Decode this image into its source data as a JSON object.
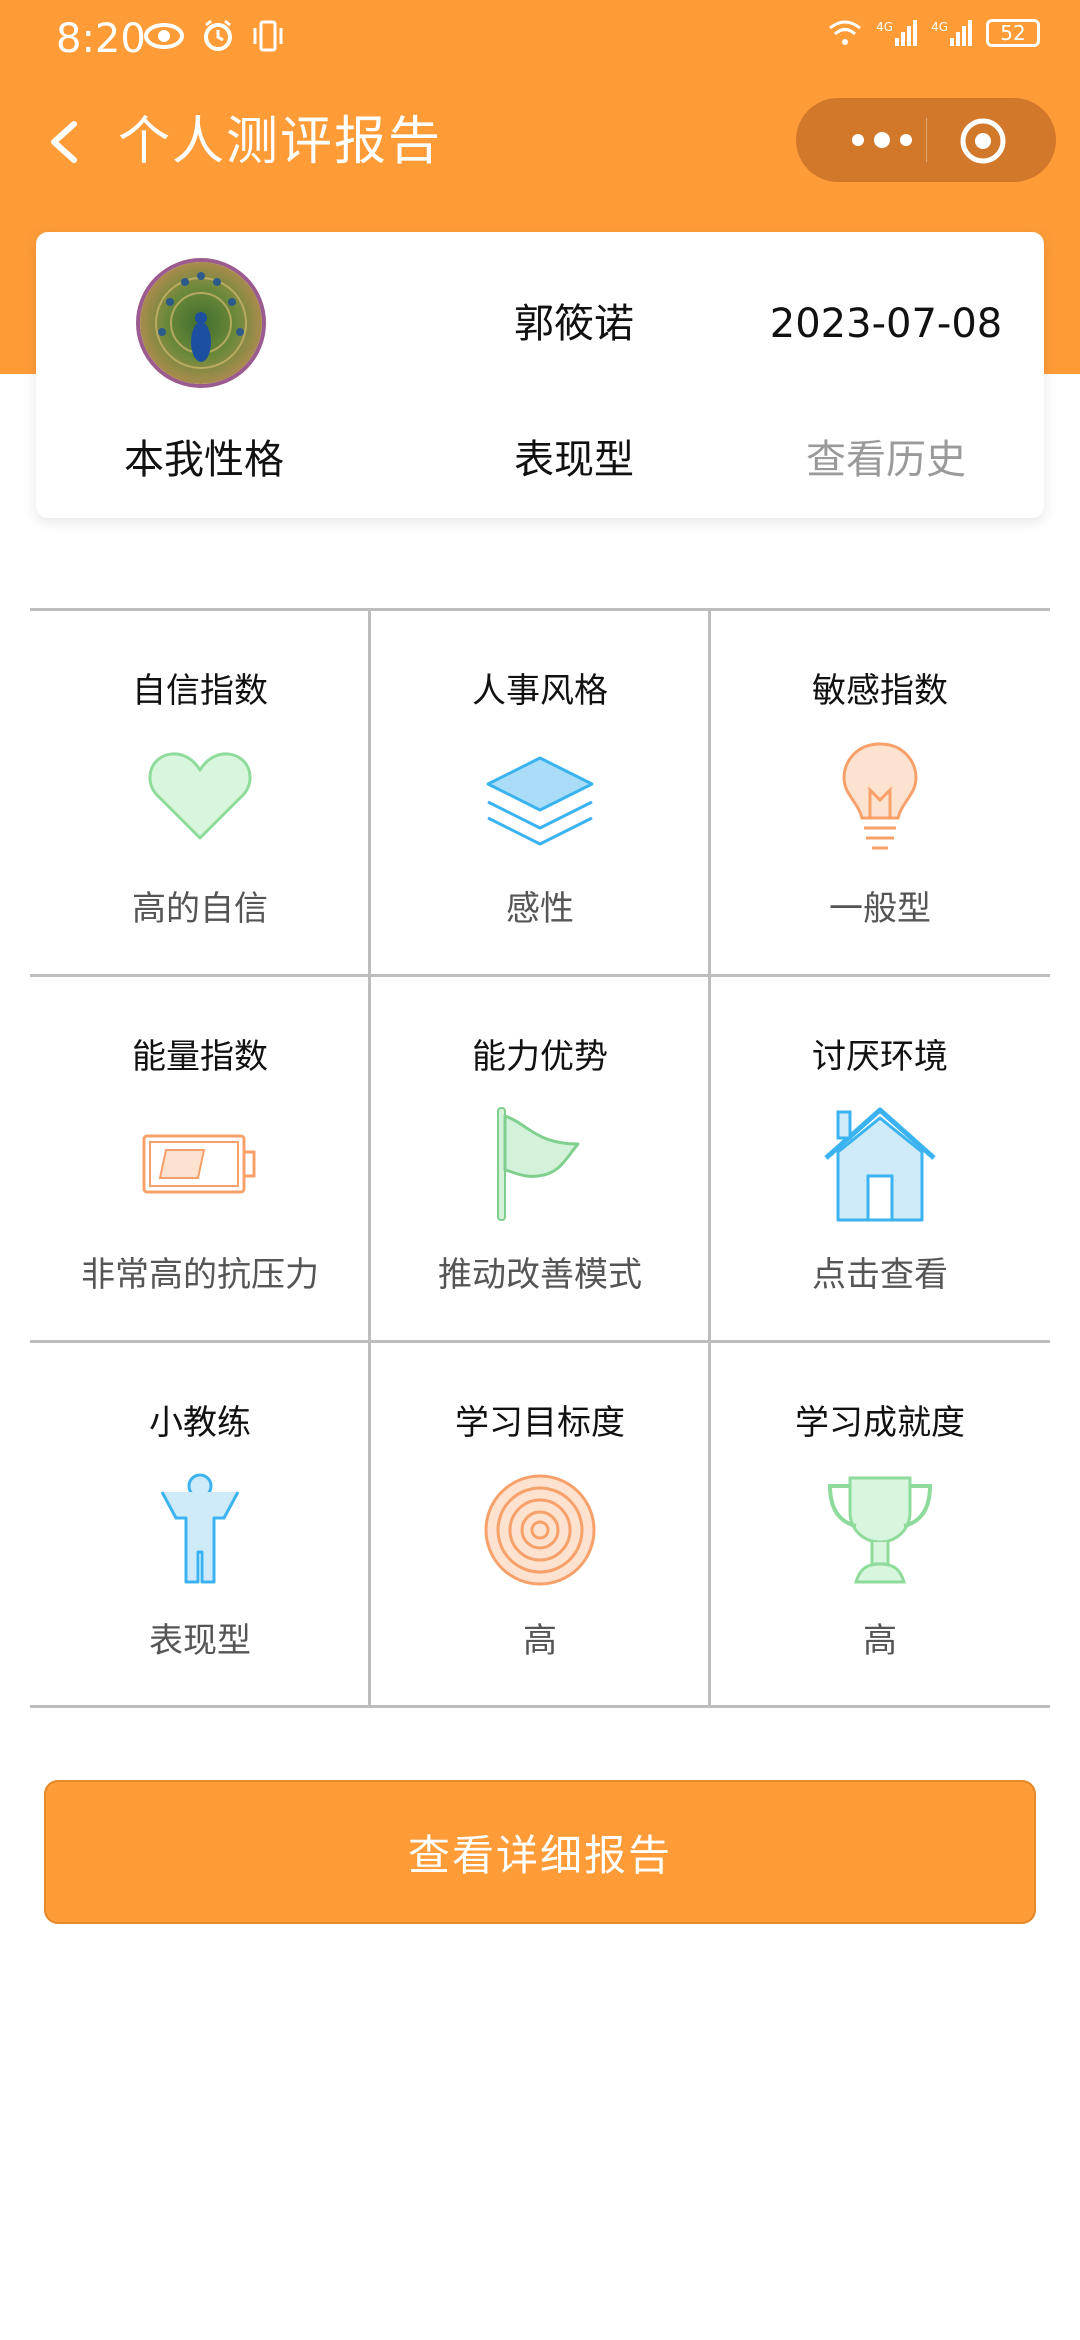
{
  "status_bar": {
    "time": "8:20",
    "battery": "52",
    "network_1": "4G",
    "network_2": "4G"
  },
  "nav": {
    "title": "个人测评报告"
  },
  "profile": {
    "name": "郭筱诺",
    "date": "2023-07-08",
    "type_label": "本我性格",
    "type_value": "表现型",
    "history_link": "查看历史"
  },
  "grid": {
    "items": [
      {
        "title": "自信指数",
        "icon": "heart-icon",
        "value": "高的自信",
        "color": "#8EDB9C"
      },
      {
        "title": "人事风格",
        "icon": "layers-icon",
        "value": "感性",
        "color": "#3BB3F0"
      },
      {
        "title": "敏感指数",
        "icon": "lightbulb-icon",
        "value": "一般型",
        "color": "#F7A06A"
      },
      {
        "title": "能量指数",
        "icon": "battery-icon",
        "value": "非常高的抗压力",
        "color": "#F7A06A"
      },
      {
        "title": "能力优势",
        "icon": "flag-icon",
        "value": "推动改善模式",
        "color": "#7FD08F"
      },
      {
        "title": "讨厌环境",
        "icon": "house-icon",
        "value": "点击查看",
        "color": "#3BB3F0"
      },
      {
        "title": "小教练",
        "icon": "person-icon",
        "value": "表现型",
        "color": "#3BB3F0"
      },
      {
        "title": "学习目标度",
        "icon": "target-icon",
        "value": "高",
        "color": "#F7A06A"
      },
      {
        "title": "学习成就度",
        "icon": "trophy-icon",
        "value": "高",
        "color": "#8EDB9C"
      }
    ]
  },
  "actions": {
    "detail_report": "查看详细报告"
  },
  "colors": {
    "accent": "#FF9C38",
    "capsule": "#D2782A"
  }
}
